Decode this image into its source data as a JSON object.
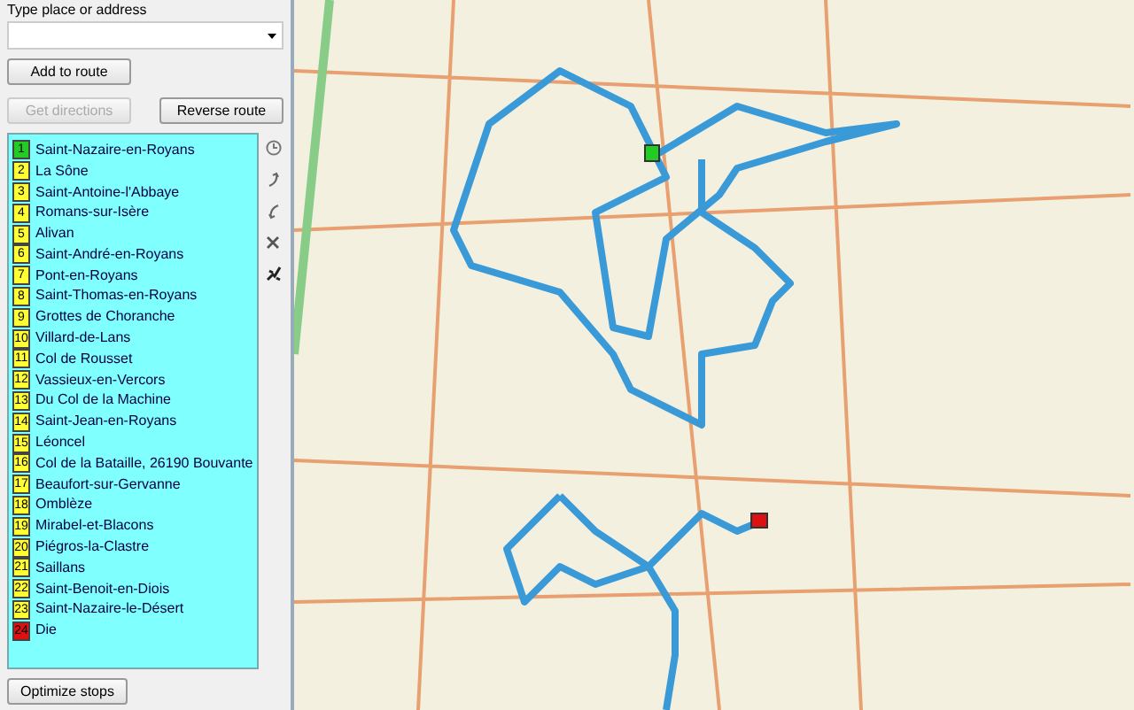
{
  "search": {
    "label": "Type place or address"
  },
  "buttons": {
    "add": {
      "label": "Add to route",
      "disabled": false
    },
    "directions": {
      "label": "Get directions",
      "disabled": true
    },
    "reverse": {
      "label": "Reverse route",
      "disabled": false
    },
    "optimize": {
      "label": "Optimize stops",
      "disabled": false
    }
  },
  "stops": [
    {
      "number": "1",
      "name": "Saint-Nazaire-en-Royans",
      "color": "#22cc22"
    },
    {
      "number": "2",
      "name": "La Sône",
      "color": "#ffff33"
    },
    {
      "number": "3",
      "name": "Saint-Antoine-l'Abbaye",
      "color": "#ffff33"
    },
    {
      "number": "4",
      "name": "Romans-sur-Isère",
      "color": "#ffff33"
    },
    {
      "number": "5",
      "name": "Alivan",
      "color": "#ffff33"
    },
    {
      "number": "6",
      "name": "Saint-André-en-Royans",
      "color": "#ffff33"
    },
    {
      "number": "7",
      "name": "Pont-en-Royans",
      "color": "#ffff33"
    },
    {
      "number": "8",
      "name": "Saint-Thomas-en-Royans",
      "color": "#ffff33"
    },
    {
      "number": "9",
      "name": "Grottes de Choranche",
      "color": "#ffff33"
    },
    {
      "number": "10",
      "name": "Villard-de-Lans",
      "color": "#ffff33"
    },
    {
      "number": "11",
      "name": "Col de Rousset",
      "color": "#ffff33"
    },
    {
      "number": "12",
      "name": "Vassieux-en-Vercors",
      "color": "#ffff33"
    },
    {
      "number": "13",
      "name": "Du Col de la Machine",
      "color": "#ffff33"
    },
    {
      "number": "14",
      "name": "Saint-Jean-en-Royans",
      "color": "#ffff33"
    },
    {
      "number": "15",
      "name": "Léoncel",
      "color": "#ffff33"
    },
    {
      "number": "16",
      "name": "Col de la Bataille, 26190 Bouvante",
      "color": "#ffff33"
    },
    {
      "number": "17",
      "name": "Beaufort-sur-Gervanne",
      "color": "#ffff33"
    },
    {
      "number": "18",
      "name": "Omblèze",
      "color": "#ffff33"
    },
    {
      "number": "19",
      "name": "Mirabel-et-Blacons",
      "color": "#ffff33"
    },
    {
      "number": "20",
      "name": "Piégros-la-Clastre",
      "color": "#ffff33"
    },
    {
      "number": "21",
      "name": "Saillans",
      "color": "#ffff33"
    },
    {
      "number": "22",
      "name": "Saint-Benoit-en-Diois",
      "color": "#ffff33"
    },
    {
      "number": "23",
      "name": "Saint-Nazaire-le-Désert",
      "color": "#ffff33"
    },
    {
      "number": "24",
      "name": "Die",
      "color": "#dd1111"
    }
  ]
}
